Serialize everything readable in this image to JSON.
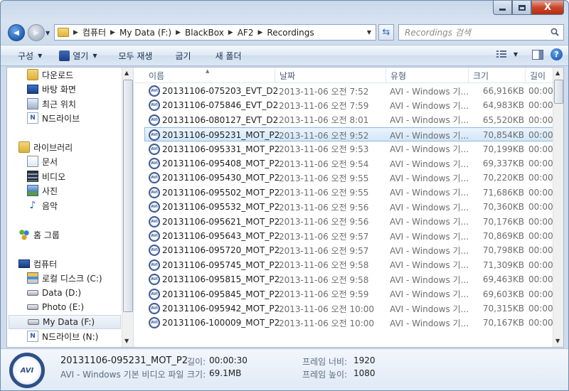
{
  "window": {
    "close_glyph": "X"
  },
  "nav": {
    "back_glyph": "◀",
    "forward_glyph": "▶",
    "breadcrumb": [
      "컴퓨터",
      "My Data (F:)",
      "BlackBox",
      "AF2",
      "Recordings"
    ],
    "search_placeholder": "Recordings 검색"
  },
  "toolbar": {
    "organize": "구성",
    "open": "열기",
    "play_all": "모두 재생",
    "burn": "굽기",
    "new_folder": "새 폴더"
  },
  "sidebar": {
    "items": [
      {
        "label": "다운로드",
        "icon": "downloads-folder-icon"
      },
      {
        "label": "바탕 화면",
        "icon": "desktop-icon"
      },
      {
        "label": "최근 위치",
        "icon": "recent-places-icon"
      },
      {
        "label": "N드라이브",
        "icon": "ndrive-icon"
      },
      {
        "label": "라이브러리",
        "icon": "libraries-icon"
      },
      {
        "label": "문서",
        "icon": "documents-icon"
      },
      {
        "label": "비디오",
        "icon": "videos-icon"
      },
      {
        "label": "사진",
        "icon": "pictures-icon"
      },
      {
        "label": "음악",
        "icon": "music-icon"
      },
      {
        "label": "홈 그룹",
        "icon": "homegroup-icon"
      },
      {
        "label": "컴퓨터",
        "icon": "computer-icon"
      },
      {
        "label": "로컬 디스크 (C:)",
        "icon": "local-disk-icon"
      },
      {
        "label": "Data (D:)",
        "icon": "drive-icon"
      },
      {
        "label": "Photo (E:)",
        "icon": "drive-icon"
      },
      {
        "label": "My Data (F:)",
        "icon": "drive-icon",
        "selected": true
      },
      {
        "label": "N드라이브 (N:)",
        "icon": "ndrive-icon"
      }
    ]
  },
  "columns": {
    "name": "이름",
    "date": "날짜",
    "type": "유형",
    "size": "크기",
    "length": "길이"
  },
  "files": [
    {
      "name": "20131106-075203_EVT_D2",
      "date": "2013-11-06 오전 7:52",
      "type": "AVI - Windows 기...",
      "size": "66,916KB",
      "length": "00:00:"
    },
    {
      "name": "20131106-075846_EVT_D2",
      "date": "2013-11-06 오전 7:59",
      "type": "AVI - Windows 기...",
      "size": "64,983KB",
      "length": "00:00:"
    },
    {
      "name": "20131106-080127_EVT_D2",
      "date": "2013-11-06 오전 8:01",
      "type": "AVI - Windows 기...",
      "size": "65,520KB",
      "length": "00:00:"
    },
    {
      "name": "20131106-095231_MOT_P2",
      "date": "2013-11-06 오전 9:52",
      "type": "AVI - Windows 기...",
      "size": "70,854KB",
      "length": "00:00:",
      "selected": true
    },
    {
      "name": "20131106-095331_MOT_P2",
      "date": "2013-11-06 오전 9:53",
      "type": "AVI - Windows 기...",
      "size": "70,199KB",
      "length": "00:00:"
    },
    {
      "name": "20131106-095408_MOT_P2",
      "date": "2013-11-06 오전 9:54",
      "type": "AVI - Windows 기...",
      "size": "69,337KB",
      "length": "00:00:"
    },
    {
      "name": "20131106-095430_MOT_P2",
      "date": "2013-11-06 오전 9:55",
      "type": "AVI - Windows 기...",
      "size": "70,220KB",
      "length": "00:00:"
    },
    {
      "name": "20131106-095502_MOT_P2",
      "date": "2013-11-06 오전 9:55",
      "type": "AVI - Windows 기...",
      "size": "71,686KB",
      "length": "00:00:"
    },
    {
      "name": "20131106-095532_MOT_P2",
      "date": "2013-11-06 오전 9:56",
      "type": "AVI - Windows 기...",
      "size": "70,360KB",
      "length": "00:00:"
    },
    {
      "name": "20131106-095621_MOT_P2",
      "date": "2013-11-06 오전 9:56",
      "type": "AVI - Windows 기...",
      "size": "70,176KB",
      "length": "00:00:"
    },
    {
      "name": "20131106-095643_MOT_P2",
      "date": "2013-11-06 오전 9:57",
      "type": "AVI - Windows 기...",
      "size": "70,869KB",
      "length": "00:00:"
    },
    {
      "name": "20131106-095720_MOT_P2",
      "date": "2013-11-06 오전 9:57",
      "type": "AVI - Windows 기...",
      "size": "70,798KB",
      "length": "00:00:"
    },
    {
      "name": "20131106-095745_MOT_P2",
      "date": "2013-11-06 오전 9:58",
      "type": "AVI - Windows 기...",
      "size": "71,309KB",
      "length": "00:00:"
    },
    {
      "name": "20131106-095815_MOT_P2",
      "date": "2013-11-06 오전 9:58",
      "type": "AVI - Windows 기...",
      "size": "69,463KB",
      "length": "00:00:"
    },
    {
      "name": "20131106-095845_MOT_P2",
      "date": "2013-11-06 오전 9:59",
      "type": "AVI - Windows 기...",
      "size": "69,603KB",
      "length": "00:00:"
    },
    {
      "name": "20131106-095942_MOT_P2",
      "date": "2013-11-06 오전 10:00",
      "type": "AVI - Windows 기...",
      "size": "70,315KB",
      "length": "00:00:"
    },
    {
      "name": "20131106-100009_MOT_P2",
      "date": "2013-11-06 오전 10:00",
      "type": "AVI - Windows 기...",
      "size": "70,167KB",
      "length": "00:00:"
    }
  ],
  "details": {
    "icon_text": "AVI",
    "filename": "20131106-095231_MOT_P2",
    "filetype": "AVI - Windows 기본 비디오 파일",
    "length_label": "길이:",
    "length_value": "00:00:30",
    "size_label": "크기:",
    "size_value": "69.1MB",
    "frame_width_label": "프레임 너비:",
    "frame_width_value": "1920",
    "frame_height_label": "프레임 높이:",
    "frame_height_value": "1080"
  }
}
